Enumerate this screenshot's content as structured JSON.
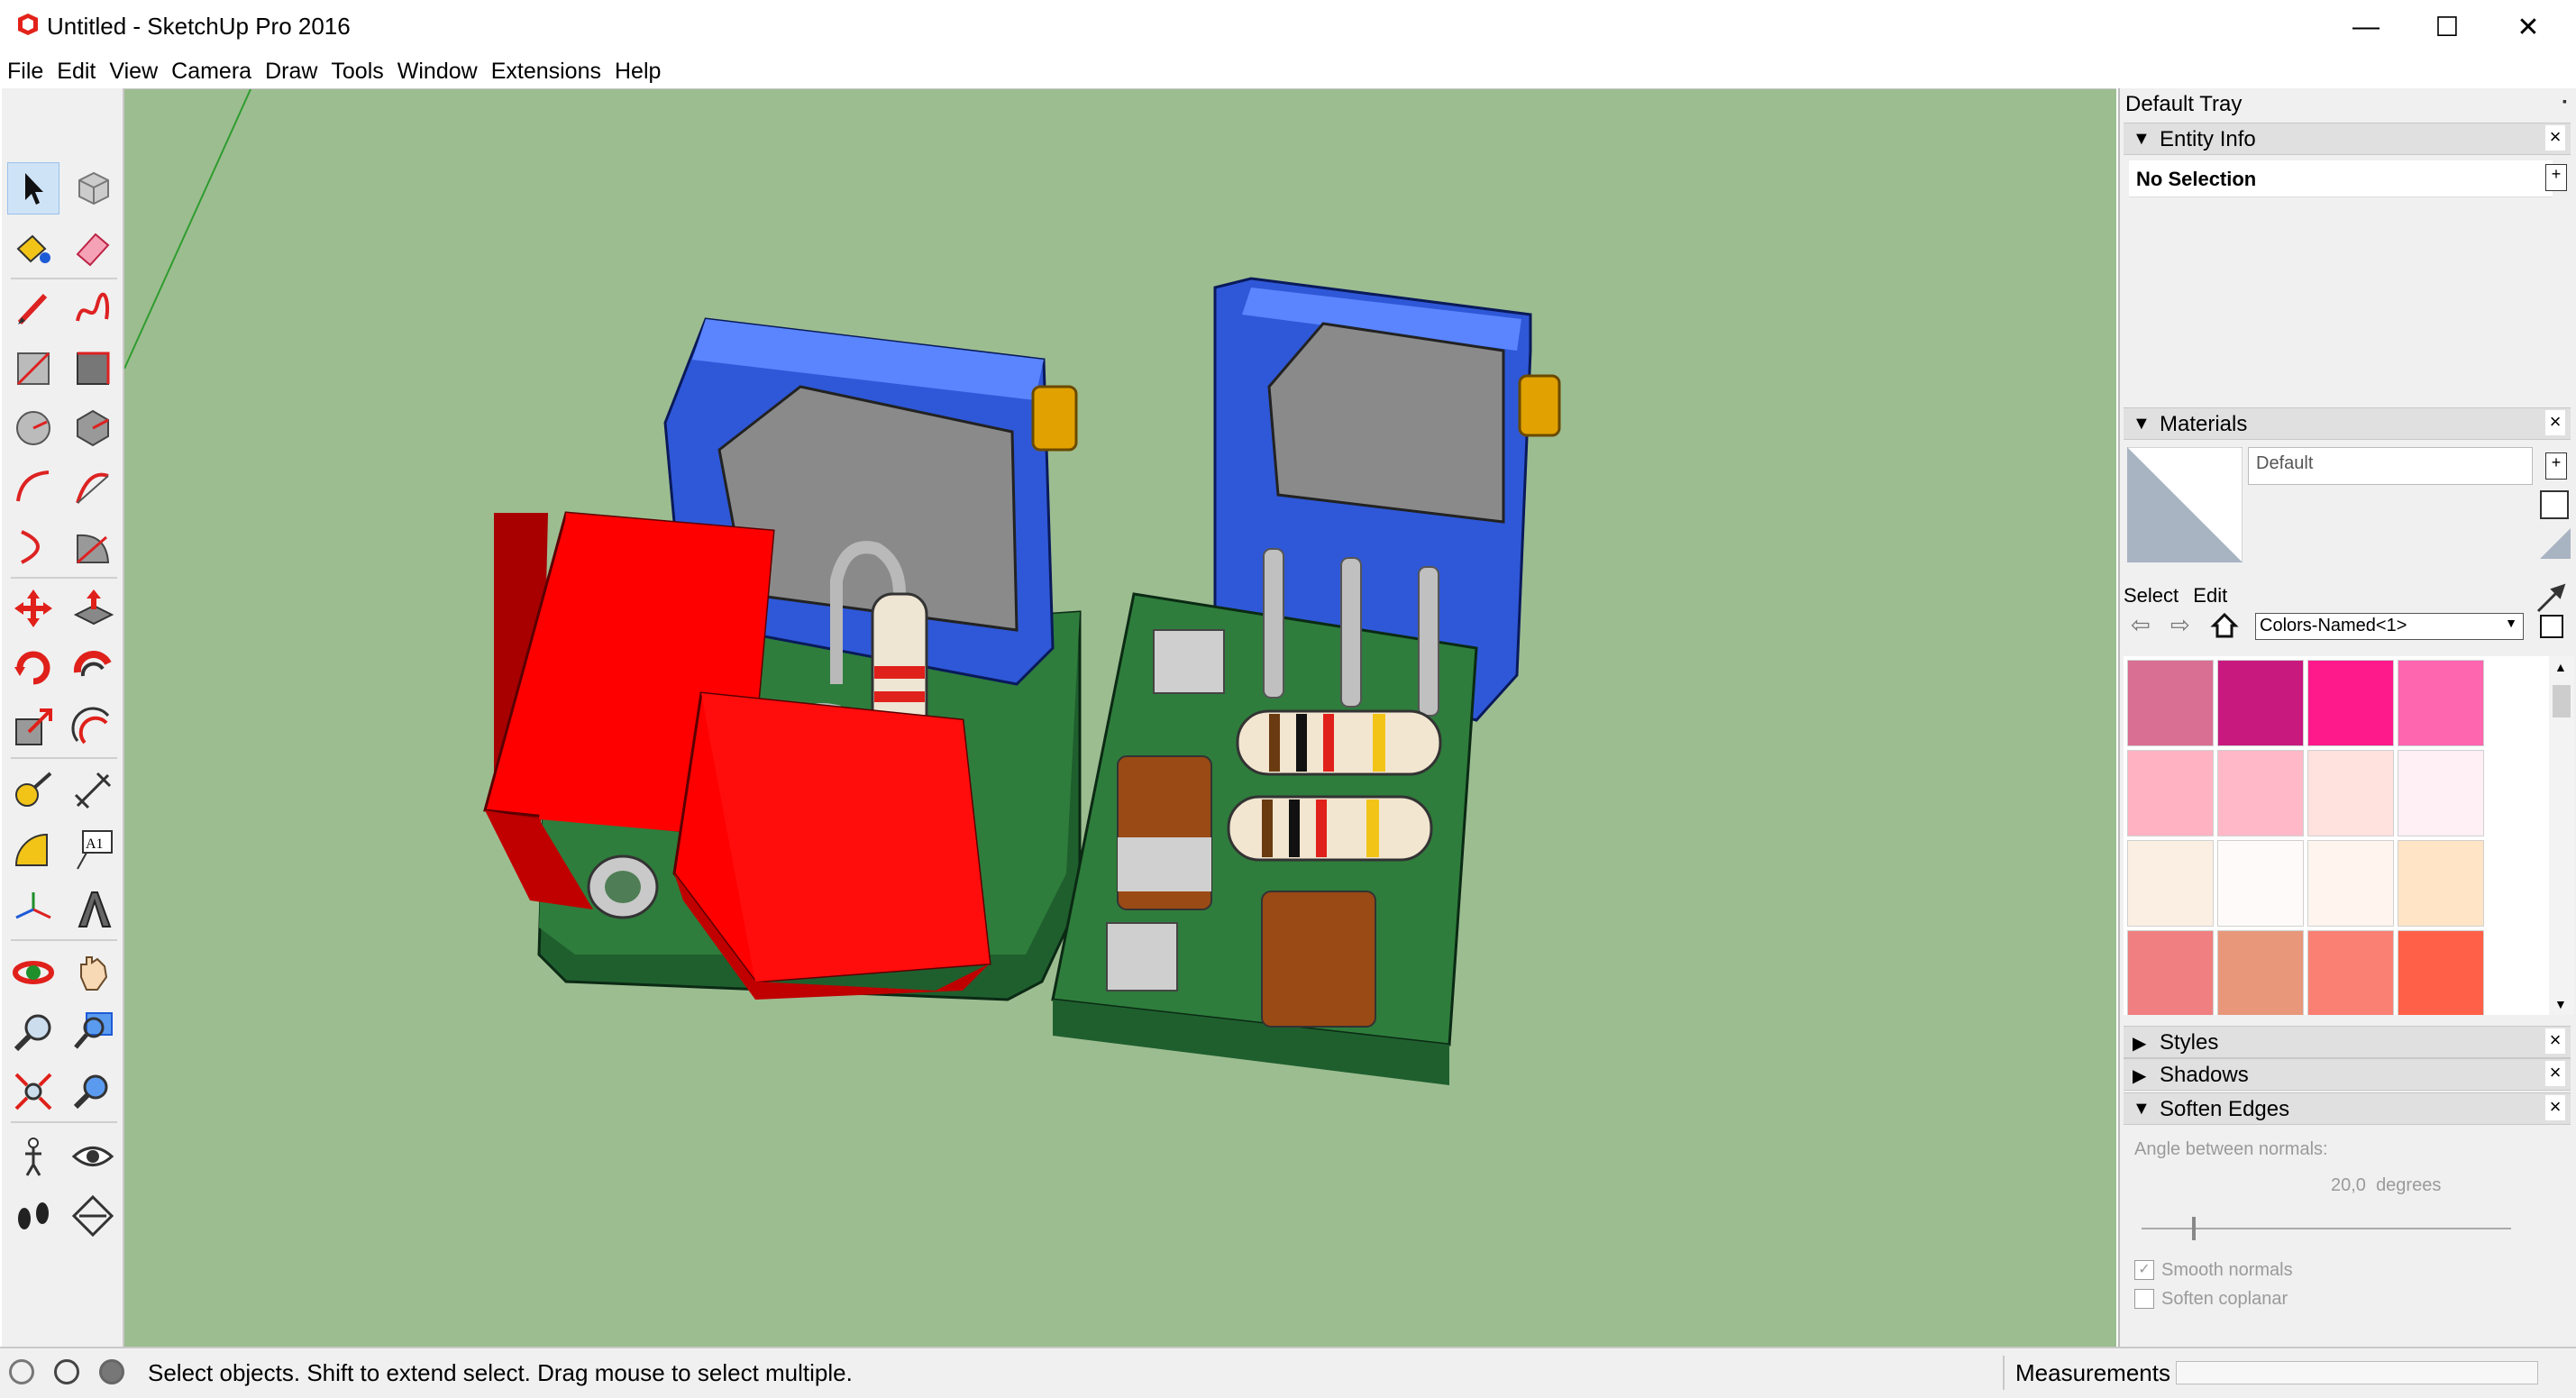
{
  "window": {
    "title": "Untitled - SketchUp Pro 2016",
    "minimize": "—",
    "maximize": "☐",
    "close": "✕"
  },
  "menu": [
    "File",
    "Edit",
    "View",
    "Camera",
    "Draw",
    "Tools",
    "Window",
    "Extensions",
    "Help"
  ],
  "toolbar": {
    "tools": [
      "select-tool-icon",
      "make-component-icon",
      "paint-bucket-icon",
      "eraser-icon",
      "line-tool-icon",
      "freehand-tool-icon",
      "rectangle-tool-icon",
      "rotated-rectangle-icon",
      "circle-tool-icon",
      "polygon-tool-icon",
      "arc-tool-icon",
      "two-point-arc-icon",
      "three-point-arc-icon",
      "pie-tool-icon",
      "move-tool-icon",
      "push-pull-icon",
      "rotate-tool-icon",
      "follow-me-icon",
      "scale-tool-icon",
      "offset-tool-icon",
      "tape-measure-icon",
      "dimension-tool-icon",
      "protractor-icon",
      "text-tool-icon",
      "axes-tool-icon",
      "3d-text-icon",
      "orbit-tool-icon",
      "pan-tool-icon",
      "zoom-tool-icon",
      "zoom-window-icon",
      "zoom-extents-icon",
      "previous-view-icon",
      "position-camera-icon",
      "look-around-icon",
      "walk-tool-icon",
      "section-plane-icon"
    ],
    "text_tool_label": "A1"
  },
  "tray": {
    "title": "Default Tray",
    "entity_info": {
      "header": "Entity Info",
      "selection": "No Selection"
    },
    "materials": {
      "header": "Materials",
      "current_name": "Default",
      "tab_select": "Select",
      "tab_edit": "Edit",
      "library": "Colors-Named<1>",
      "swatches": [
        "#d96f92",
        "#c7197e",
        "#ff1a8c",
        "#ff66b0",
        "#ffb3c2",
        "#ffb8c8",
        "#ffe1de",
        "#fff0f5",
        "#fbefe3",
        "#fffafa",
        "#fff4ee",
        "#ffe4c6",
        "#ef7f80",
        "#e8977a",
        "#f98072",
        "#ff6047"
      ]
    },
    "styles": {
      "header": "Styles"
    },
    "shadows": {
      "header": "Shadows"
    },
    "soften_edges": {
      "header": "Soften Edges",
      "angle_label": "Angle between normals:",
      "angle_value": "20,0",
      "angle_unit": "degrees",
      "smooth_normals": "Smooth normals",
      "smooth_normals_checked": true,
      "soften_coplanar": "Soften coplanar",
      "soften_coplanar_checked": false
    }
  },
  "status": {
    "hint": "Select objects. Shift to extend select. Drag mouse to select multiple.",
    "measurements_label": "Measurements",
    "measurements_value": ""
  },
  "colors": {
    "viewport_bg": "#9cbd90",
    "pcb": "#2e7d3c",
    "relay_red": "#ff0000",
    "pot_blue": "#4a78f0"
  }
}
